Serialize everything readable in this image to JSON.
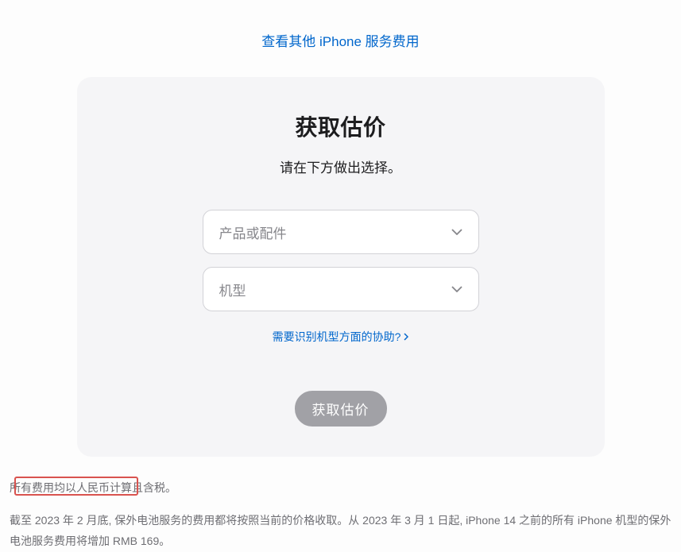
{
  "topLink": {
    "label": "查看其他 iPhone 服务费用"
  },
  "card": {
    "title": "获取估价",
    "subtitle": "请在下方做出选择。",
    "select1": {
      "placeholder": "产品或配件"
    },
    "select2": {
      "placeholder": "机型"
    },
    "helpLink": "需要识别机型方面的协助?",
    "button": "获取估价"
  },
  "footnotes": {
    "note1": "所有费用均以人民币计算且含税。",
    "note2_part1": "截至 2023 年 2 月底, 保外电池服务的费用都将按照当前的价格收取。从 2023 年 3 月 1 日起, iPhone 14 之前的所有 iPhone 机型的保外电池服务",
    "note2_part2": "费用将增加 RMB 169。"
  }
}
